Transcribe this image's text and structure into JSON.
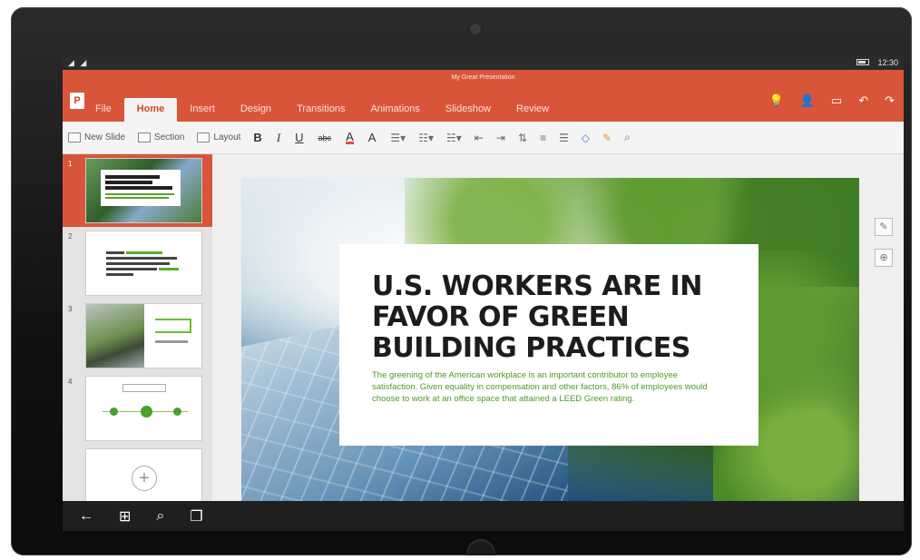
{
  "status": {
    "signal": "◢ ◢",
    "time": "12:30"
  },
  "ribbon": {
    "doc_title": "My Great Presentation",
    "app_letter": "P",
    "tabs": [
      {
        "label": "File"
      },
      {
        "label": "Home"
      },
      {
        "label": "Insert"
      },
      {
        "label": "Design"
      },
      {
        "label": "Transitions"
      },
      {
        "label": "Animations"
      },
      {
        "label": "Slideshow"
      },
      {
        "label": "Review"
      }
    ]
  },
  "toolbar": {
    "new_slide": "New Slide",
    "section": "Section",
    "layout": "Layout",
    "bold": "B",
    "italic": "I",
    "underline": "U",
    "strike": "abc",
    "font_color": "A",
    "highlight": "A"
  },
  "thumbnails": [
    {
      "number": "1"
    },
    {
      "number": "2"
    },
    {
      "number": "3"
    },
    {
      "number": "4"
    }
  ],
  "slide": {
    "headline_1": "U.S. WORKERS ARE IN",
    "headline_2": "FAVOR OF GREEN",
    "headline_3": "BUILDING PRACTICES",
    "body": "The greening of the American workplace is an important contributor to employee satisfaction. Given equality in compensation and other factors, 86% of employees would choose to work at an office space that attained a LEED Green rating.",
    "thumb1_title": "U.S. WORKERS ARE IN FAVOR OF GREEN BUILDING PRACTICES"
  },
  "colors": {
    "accent": "#d9553a",
    "green_text": "#4c9a27",
    "taskbar": "#1f1f1f"
  }
}
